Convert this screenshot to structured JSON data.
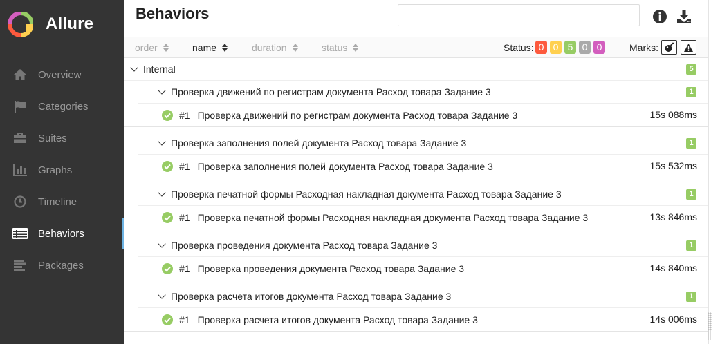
{
  "app": {
    "brand": "Allure"
  },
  "sidebar": {
    "items": [
      {
        "label": "Overview",
        "icon": "home-icon",
        "active": false
      },
      {
        "label": "Categories",
        "icon": "flag-icon",
        "active": false
      },
      {
        "label": "Suites",
        "icon": "briefcase-icon",
        "active": false
      },
      {
        "label": "Graphs",
        "icon": "bar-chart-icon",
        "active": false
      },
      {
        "label": "Timeline",
        "icon": "clock-icon",
        "active": false
      },
      {
        "label": "Behaviors",
        "icon": "list-icon",
        "active": true
      },
      {
        "label": "Packages",
        "icon": "align-left-icon",
        "active": false
      }
    ]
  },
  "header": {
    "title": "Behaviors",
    "search": {
      "value": "",
      "placeholder": ""
    }
  },
  "sortbar": {
    "order": "order",
    "name": "name",
    "duration": "duration",
    "status": "status",
    "status_label": "Status:",
    "marks_label": "Marks:"
  },
  "status_counts": [
    {
      "value": "0",
      "color": "#fd5a3e",
      "status": "failed"
    },
    {
      "value": "0",
      "color": "#ffd050",
      "status": "broken"
    },
    {
      "value": "5",
      "color": "#97cc64",
      "status": "passed"
    },
    {
      "value": "0",
      "color": "#aaaaaa",
      "status": "skipped"
    },
    {
      "value": "0",
      "color": "#d35ebe",
      "status": "unknown"
    }
  ],
  "tree": {
    "root": {
      "label": "Internal",
      "count": "5"
    },
    "groups": [
      {
        "label": "Проверка движений по регистрам документа Расход товара Задание 3",
        "count": "1",
        "test": {
          "num": "#1",
          "label": "Проверка движений по регистрам документа Расход товара Задание 3",
          "duration": "15s 088ms"
        }
      },
      {
        "label": "Проверка заполнения полей документа Расход товара Задание 3",
        "count": "1",
        "test": {
          "num": "#1",
          "label": "Проверка заполнения полей документа Расход товара Задание 3",
          "duration": "15s 532ms"
        }
      },
      {
        "label": "Проверка печатной формы Расходная накладная документа Расход товара Задание 3",
        "count": "1",
        "test": {
          "num": "#1",
          "label": "Проверка печатной формы Расходная накладная документа Расход товара Задание 3",
          "duration": "13s 846ms"
        }
      },
      {
        "label": "Проверка проведения документа Расход товара Задание 3",
        "count": "1",
        "test": {
          "num": "#1",
          "label": "Проверка проведения документа Расход товара Задание 3",
          "duration": "14s 840ms"
        }
      },
      {
        "label": "Проверка расчета итогов документа Расход товара Задание 3",
        "count": "1",
        "test": {
          "num": "#1",
          "label": "Проверка расчета итогов документа Расход товара Задание 3",
          "duration": "14s 006ms"
        }
      }
    ]
  }
}
